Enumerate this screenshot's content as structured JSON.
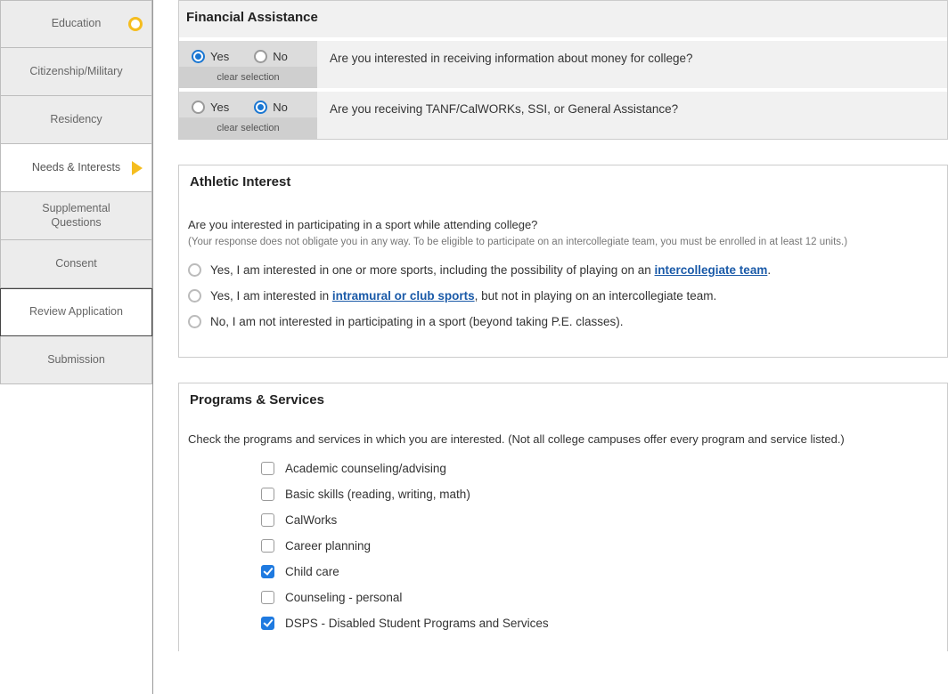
{
  "sidebar": {
    "items": [
      {
        "label": "Education",
        "status": "ring"
      },
      {
        "label": "Citizenship/Military"
      },
      {
        "label": "Residency"
      },
      {
        "label": "Needs & Interests",
        "status": "arrow",
        "active": true
      },
      {
        "label": "Supplemental Questions"
      },
      {
        "label": "Consent"
      },
      {
        "label": "Review Application",
        "review": true
      },
      {
        "label": "Submission"
      }
    ]
  },
  "financial": {
    "heading": "Financial Assistance",
    "yes": "Yes",
    "no": "No",
    "clear": "clear selection",
    "q1": "Are you interested in receiving information about money for college?",
    "q2": "Are you receiving TANF/CalWORKs, SSI, or General Assistance?",
    "row1_selected": "yes",
    "row2_selected": "no"
  },
  "athletic": {
    "heading": "Athletic Interest",
    "question": "Are you interested in participating in a sport while attending college?",
    "note": "(Your response does not obligate you in any way. To be eligible to participate on an intercollegiate team, you must be enrolled in at least 12 units.)",
    "opt1_pre": "Yes, I am interested in one or more sports, including the possibility of playing on an ",
    "opt1_link": "intercollegiate team",
    "opt1_post": ".",
    "opt2_pre": "Yes, I am interested in ",
    "opt2_link": "intramural or club sports",
    "opt2_post": ", but not in playing on an intercollegiate team.",
    "opt3": "No, I am not interested in participating in a sport (beyond taking P.E. classes)."
  },
  "programs": {
    "heading": "Programs & Services",
    "intro": "Check the programs and services in which you are interested. (Not all college campuses offer every program and service listed.)",
    "items": [
      {
        "label": "Academic counseling/advising",
        "checked": false
      },
      {
        "label": "Basic skills (reading, writing, math)",
        "checked": false
      },
      {
        "label": "CalWorks",
        "checked": false
      },
      {
        "label": "Career planning",
        "checked": false
      },
      {
        "label": "Child care",
        "checked": true
      },
      {
        "label": "Counseling - personal",
        "checked": false
      },
      {
        "label": "DSPS - Disabled Student Programs and Services",
        "checked": true
      }
    ]
  }
}
